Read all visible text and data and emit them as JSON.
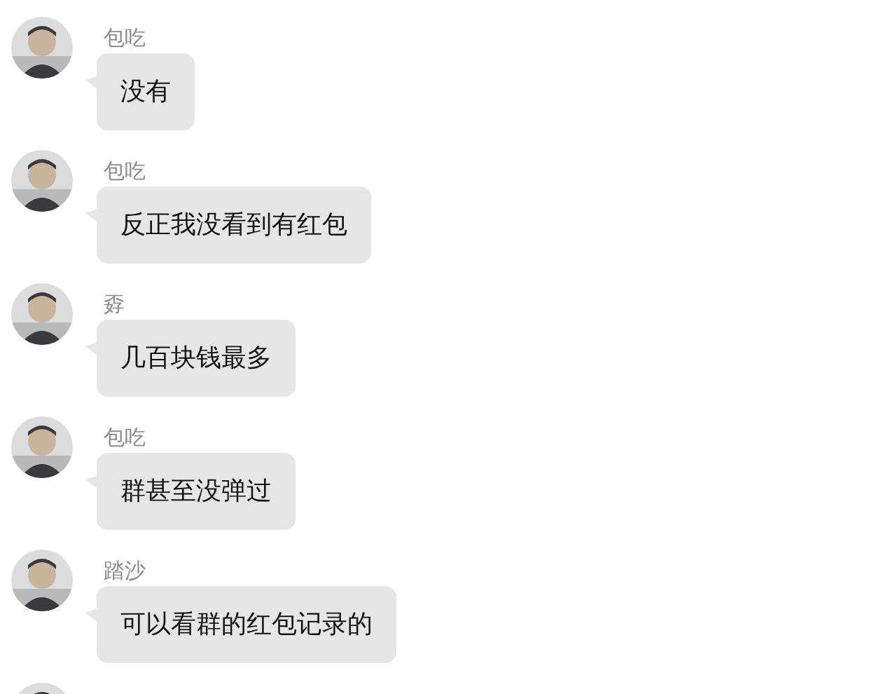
{
  "messages": [
    {
      "sender": "包吃",
      "text": "没有"
    },
    {
      "sender": "包吃",
      "text": "反正我没看到有红包"
    },
    {
      "sender": "孬",
      "text": "几百块钱最多"
    },
    {
      "sender": "包吃",
      "text": "群甚至没弹过"
    },
    {
      "sender": "踏沙",
      "text": "可以看群的红包记录的"
    }
  ]
}
